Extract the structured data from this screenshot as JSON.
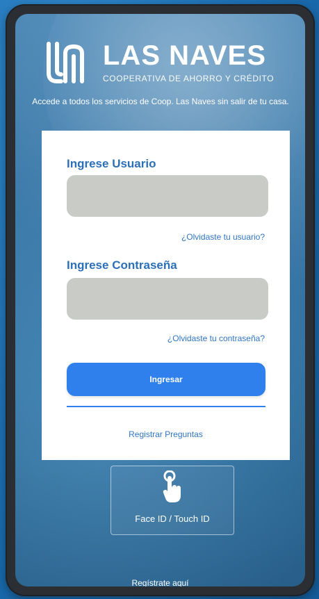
{
  "brand": {
    "name": "LAS NAVES",
    "subtitle": "COOPERATIVA DE AHORRO Y CRÉDITO",
    "tagline": "Accede a todos los servicios de Coop. Las Naves sin salir de tu casa."
  },
  "login": {
    "user_label": "Ingrese Usuario",
    "user_value": "",
    "forgot_user": "¿Olvidaste tu usuario?",
    "password_label": "Ingrese Contraseña",
    "password_value": "",
    "forgot_password": "¿Olvidaste tu contraseña?",
    "submit": "Ingresar",
    "register_questions": "Registrar Preguntas"
  },
  "biometric": {
    "label": "Face ID / Touch ID",
    "icon": "touch-hand-icon"
  },
  "footer": {
    "register": "Regístrate aquí"
  },
  "colors": {
    "accent": "#2f80ec",
    "label": "#2b6fb8",
    "input_bg": "#c9cbc6",
    "frame": "#2b2f33"
  }
}
